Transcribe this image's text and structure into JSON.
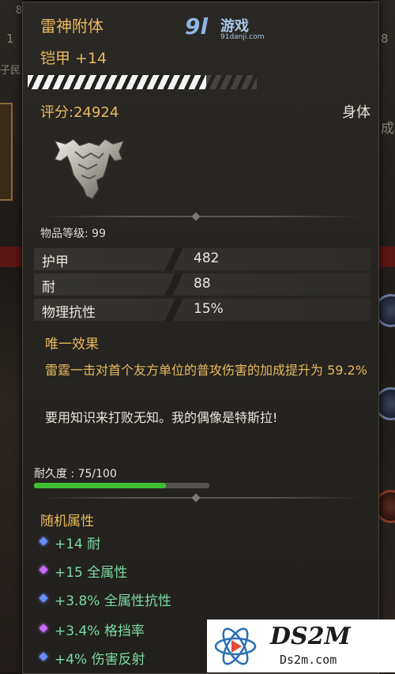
{
  "background": {
    "left_chars": [
      "1",
      "8",
      "子民",
      "8"
    ],
    "right_chars": [
      "成"
    ]
  },
  "watermark_91": {
    "mark": "9l",
    "name": "游戏",
    "url": "91danji.com"
  },
  "item": {
    "name": "雷神附体",
    "subtitle": "铠甲 +14",
    "upgrade_progress": 0.78,
    "score": "评分:24924",
    "slot": "身体",
    "icon": "chest-armor-icon",
    "item_level_label": "物品等级: 99",
    "stats": [
      {
        "name": "护甲",
        "value": "482"
      },
      {
        "name": "耐",
        "value": "88"
      },
      {
        "name": "物理抗性",
        "value": "15%"
      }
    ],
    "unique_title": "唯一效果",
    "unique_text": "雷霆一击对首个友方单位的普攻伤害的加成提升为 59.2%",
    "flavor_text": "要用知识来打败无知。我的偶像是特斯拉!",
    "durability_label": "耐久度 : 75/100",
    "durability_fraction": 0.75,
    "random_title": "随机属性",
    "affixes": [
      {
        "text": "+14 耐",
        "gem_color": "#6a8cff"
      },
      {
        "text": "+15 全属性",
        "gem_color": "#c76bff"
      },
      {
        "text": "+3.8% 全属性抗性",
        "gem_color": "#6a8cff"
      },
      {
        "text": "+3.4% 格挡率",
        "gem_color": "#c76bff"
      },
      {
        "text": "+4% 伤害反射",
        "gem_color": "#6a8cff"
      }
    ]
  },
  "colors": {
    "gold": "#e7b95e",
    "affix_green": "#7bd9a3",
    "durability_green": "#3fbf34"
  },
  "ds2m": {
    "name": "DS2M",
    "url": "Ds2m.com"
  }
}
